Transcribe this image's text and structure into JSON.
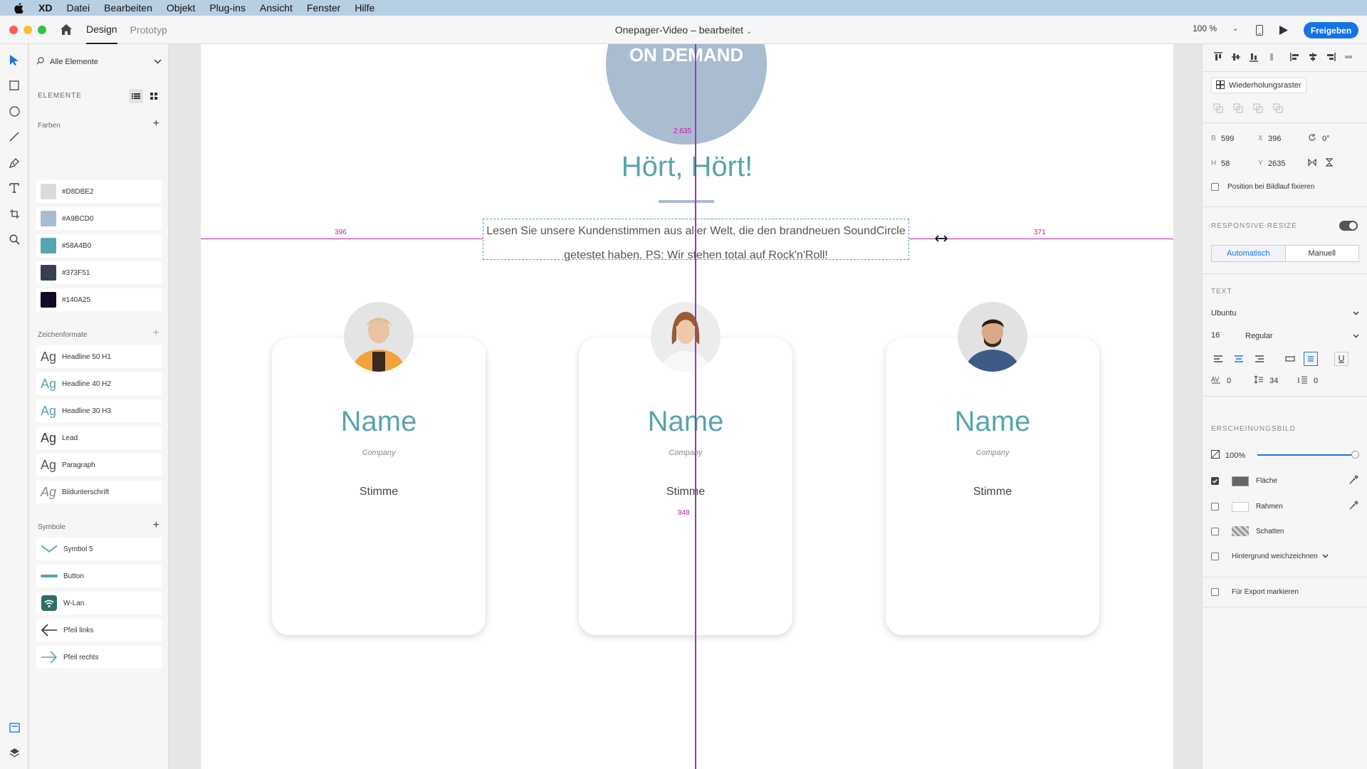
{
  "menubar": {
    "items": [
      "XD",
      "Datei",
      "Bearbeiten",
      "Objekt",
      "Plug-ins",
      "Ansicht",
      "Fenster",
      "Hilfe"
    ]
  },
  "titlebar": {
    "tab_design": "Design",
    "tab_prototype": "Prototyp",
    "document_title": "Onepager-Video – bearbeitet",
    "zoom": "100 %",
    "share_label": "Freigeben"
  },
  "assets": {
    "filter_label": "Alle Elemente",
    "elements_title": "ELEMENTE",
    "colors_title": "Farben",
    "colors": [
      {
        "hex": "#D8DBE2",
        "value": "#D8DBE2"
      },
      {
        "hex": "#A9BCD0",
        "value": "#A9BCD0"
      },
      {
        "hex": "#58A4B0",
        "value": "#58A4B0"
      },
      {
        "hex": "#373F51",
        "value": "#373F51"
      },
      {
        "hex": "#140A25",
        "value": "#140A25"
      }
    ],
    "char_styles_title": "Zeichenformate",
    "char_styles": [
      {
        "sample": "Ag",
        "label": "Headline 50 H1",
        "color": "#555555"
      },
      {
        "sample": "Ag",
        "label": "Headline 40 H2",
        "color": "#58A4B0"
      },
      {
        "sample": "Ag",
        "label": "Headline 30 H3",
        "color": "#58A4B0"
      },
      {
        "sample": "Ag",
        "label": "Lead",
        "color": "#333333"
      },
      {
        "sample": "Ag",
        "label": "Paragraph",
        "color": "#555555"
      },
      {
        "sample": "Ag",
        "label": "Bildunterschrift",
        "color": "#888888"
      }
    ],
    "symbols_title": "Symbole",
    "symbols": [
      {
        "label": "Symbol 5",
        "icon": "chevron-icon"
      },
      {
        "label": "Button",
        "icon": "button-bar-icon"
      },
      {
        "label": "W-Lan",
        "icon": "wifi-icon"
      },
      {
        "label": "Pfeil links",
        "icon": "arrow-left-icon"
      },
      {
        "label": "Pfeil rechts",
        "icon": "arrow-right-icon"
      }
    ]
  },
  "canvas": {
    "hero_text": "ON DEMAND",
    "headline": "Hört, Hört!",
    "lead_line1": "Lesen Sie unsere Kundenstimmen aus aller Welt, die den brandneuen SoundCircle",
    "lead_line2": "getestet haben. PS: Wir stehen total auf Rock'n'Roll!",
    "measure_top": "2.635",
    "measure_left": "396",
    "measure_right": "371",
    "measure_bottom": "948",
    "cards": [
      {
        "name": "Name",
        "company": "Company",
        "quote": "Stimme"
      },
      {
        "name": "Name",
        "company": "Company",
        "quote": "Stimme"
      },
      {
        "name": "Name",
        "company": "Company",
        "quote": "Stimme"
      }
    ]
  },
  "inspector": {
    "repeat_grid": "Wiederholungsraster",
    "w_label": "B",
    "w_value": "599",
    "x_label": "X",
    "x_value": "396",
    "rotation": "0°",
    "h_label": "H",
    "h_value": "58",
    "y_label": "Y",
    "y_value": "2635",
    "fix_position": "Position bei Bildlauf fixieren",
    "responsive_title": "RESPONSIVE RESIZE",
    "auto_label": "Automatisch",
    "manual_label": "Manuell",
    "text_title": "TEXT",
    "font_family": "Ubuntu",
    "font_size": "16",
    "font_weight": "Regular",
    "char_spacing": "0",
    "line_spacing": "34",
    "paragraph_spacing": "0",
    "appearance_title": "ERSCHEINUNGSBILD",
    "opacity": "100%",
    "opacity_fraction": 1.0,
    "fill_label": "Fläche",
    "border_label": "Rahmen",
    "shadow_label": "Schatten",
    "blur_label": "Hintergrund weichzeichnen",
    "export_label": "Für Export markieren"
  }
}
